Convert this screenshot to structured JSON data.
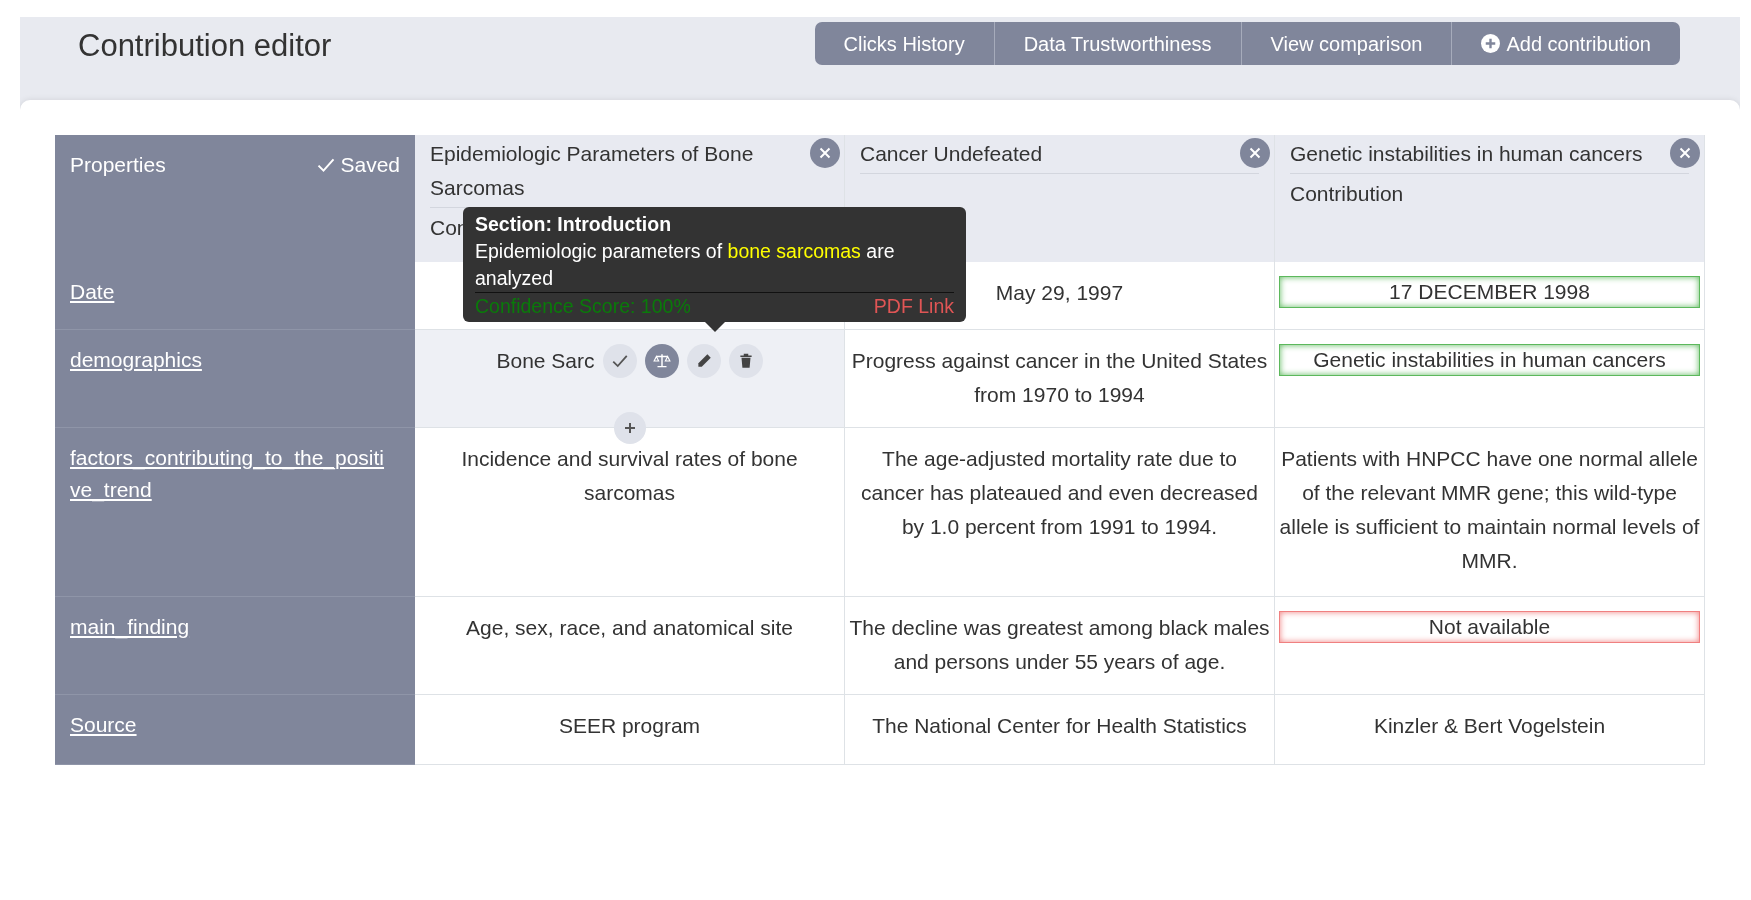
{
  "header": {
    "title": "Contribution editor",
    "buttons": [
      {
        "label": "Clicks History",
        "kind": "plain"
      },
      {
        "label": "Data Trustworthiness",
        "kind": "plain"
      },
      {
        "label": "View comparison",
        "kind": "plain"
      },
      {
        "label": "Add contribution",
        "kind": "add"
      }
    ]
  },
  "properties_heading": "Properties",
  "save_status": "Saved",
  "contributions": [
    {
      "title": "Epidemiologic Parameters of Bone Sarcomas",
      "subtitle": "Con"
    },
    {
      "title": "Cancer Undefeated"
    },
    {
      "title": "Genetic instabilities in human cancers",
      "subtitle": "Contribution"
    }
  ],
  "rows": [
    {
      "property": "Date",
      "cells": [
        {},
        {
          "value": "May 29, 1997"
        },
        {
          "value": "17 DECEMBER 1998",
          "color": "#5cb85c"
        }
      ]
    },
    {
      "property": "demographics",
      "cells": [
        {
          "value": "Bone Sarc",
          "active": true,
          "actions": [
            {
              "kind": "accept",
              "selected": false
            },
            {
              "kind": "compare",
              "selected": true
            },
            {
              "kind": "edit",
              "selected": false
            },
            {
              "kind": "delete",
              "selected": false
            }
          ]
        },
        {
          "value": "Progress against cancer in the United States from 1970 to 1994",
          "active": false
        },
        {
          "value": "Genetic instabilities in human cancers",
          "color": "#5cb85c"
        }
      ]
    },
    {
      "property": "factors_contributing_to_the_positive_trend",
      "cells": [
        {
          "value": "Incidence and survival rates of bone sarcomas"
        },
        {
          "value": "The age-adjusted mortality rate due to cancer has plateaued and even decreased by 1.0 percent from 1991 to 1994."
        },
        {
          "value": "Patients with HNPCC have one normal allele of the relevant MMR gene; this wild-type allele is sufficient to maintain normal levels of MMR."
        }
      ]
    },
    {
      "property": "main_finding",
      "cells": [
        {
          "value": "Age, sex, race, and anatomical site"
        },
        {
          "value": "The decline was greatest among black males and persons under 55 years of age."
        },
        {
          "value": "Not available",
          "color": "#f08080"
        }
      ]
    },
    {
      "property": "Source",
      "cells": [
        {
          "value": "SEER program"
        },
        {
          "value": "The National Center for Health Statistics"
        },
        {
          "value": "Kinzler & Bert Vogelstein"
        }
      ]
    }
  ],
  "tooltip": {
    "heading": "Section: Introduction",
    "text": "Epidemiologic parameters of **bone sarcomas** are analyzed",
    "confidence": "Confidence Score: 100%",
    "link": "PDF Link"
  }
}
